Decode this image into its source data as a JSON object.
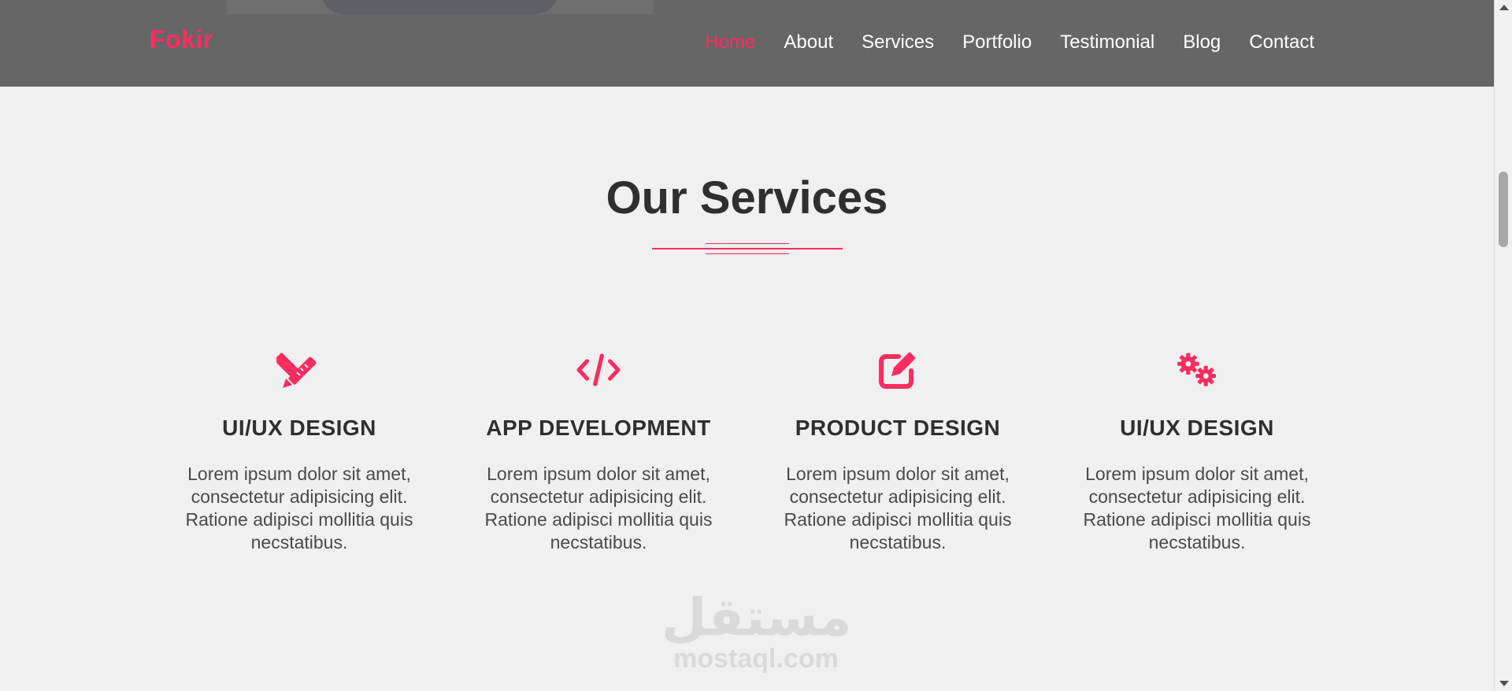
{
  "brand": {
    "logo": "Fokir",
    "accent_color": "#ff2c5f"
  },
  "nav": {
    "items": [
      {
        "label": "Home",
        "active": true
      },
      {
        "label": "About",
        "active": false
      },
      {
        "label": "Services",
        "active": false
      },
      {
        "label": "Portfolio",
        "active": false
      },
      {
        "label": "Testimonial",
        "active": false
      },
      {
        "label": "Blog",
        "active": false
      },
      {
        "label": "Contact",
        "active": false
      }
    ]
  },
  "section": {
    "title": "Our Services"
  },
  "services": [
    {
      "icon": "pencil-ruler-icon",
      "title": "UI/UX DESIGN",
      "text": "Lorem ipsum dolor sit amet, consectetur adipisicing elit. Ratione adipisci mollitia quis necstatibus."
    },
    {
      "icon": "code-icon",
      "title": "APP DEVELOPMENT",
      "text": "Lorem ipsum dolor sit amet, consectetur adipisicing elit. Ratione adipisci mollitia quis necstatibus."
    },
    {
      "icon": "edit-icon",
      "title": "PRODUCT DESIGN",
      "text": "Lorem ipsum dolor sit amet, consectetur adipisicing elit. Ratione adipisci mollitia quis necstatibus."
    },
    {
      "icon": "cogs-icon",
      "title": "UI/UX DESIGN",
      "text": "Lorem ipsum dolor sit amet, consectetur adipisicing elit. Ratione adipisci mollitia quis necstatibus."
    }
  ],
  "watermark": {
    "arabic": "مستقل",
    "latin": "mostaql.com"
  }
}
